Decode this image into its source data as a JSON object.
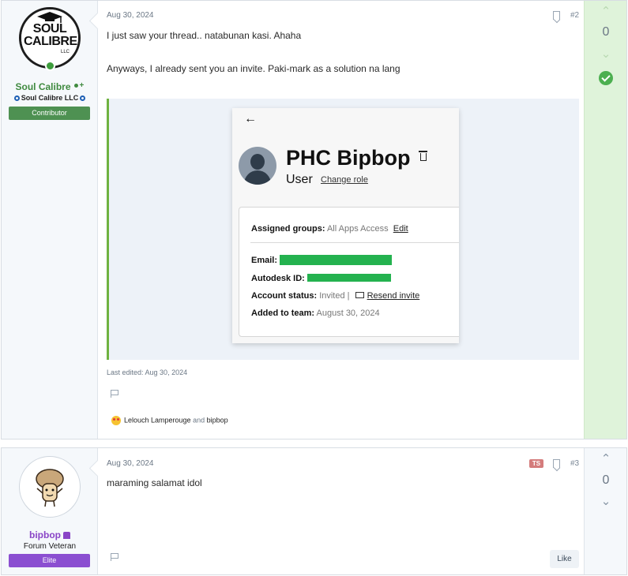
{
  "posts": [
    {
      "user": {
        "name": "Soul Calibre",
        "logo_text": "SOUL CALIBRE",
        "logo_suffix": "LLC",
        "title": "Soul Calibre LLC",
        "banner": "Contributor"
      },
      "date": "Aug 30, 2024",
      "number": "#2",
      "message": [
        "I just saw your thread.. natabunan kasi. Ahaha",
        "Anyways, I already sent you an invite. Paki-mark as a solution na lang"
      ],
      "attachment": {
        "name": "PHC Bipbop",
        "role": "User",
        "change_role": "Change role",
        "rows": {
          "assigned_label": "Assigned groups:",
          "assigned_value": "All Apps Access",
          "edit": "Edit",
          "email_label": "Email:",
          "autodesk_label": "Autodesk ID:",
          "status_label": "Account status:",
          "status_value": "Invited",
          "status_sep": "|",
          "resend": "Resend invite",
          "added_label": "Added to team:",
          "added_value": "August 30, 2024"
        }
      },
      "last_edited": "Last edited: Aug 30, 2024",
      "reactions": {
        "user1": "Lelouch Lamperouge",
        "and": "and",
        "user2": "bipbop"
      },
      "vote_count": "0"
    },
    {
      "user": {
        "name": "bipbop",
        "title": "Forum Veteran",
        "banner": "Elite"
      },
      "date": "Aug 30, 2024",
      "number": "#3",
      "ts": "TS",
      "message": "maraming salamat idol",
      "like": "Like",
      "vote_count": "0"
    }
  ],
  "colors": {
    "solution_bg": "#dff3da",
    "contributor": "#4e9152",
    "elite": "#8b4fd1",
    "redaction": "#24b24f"
  }
}
